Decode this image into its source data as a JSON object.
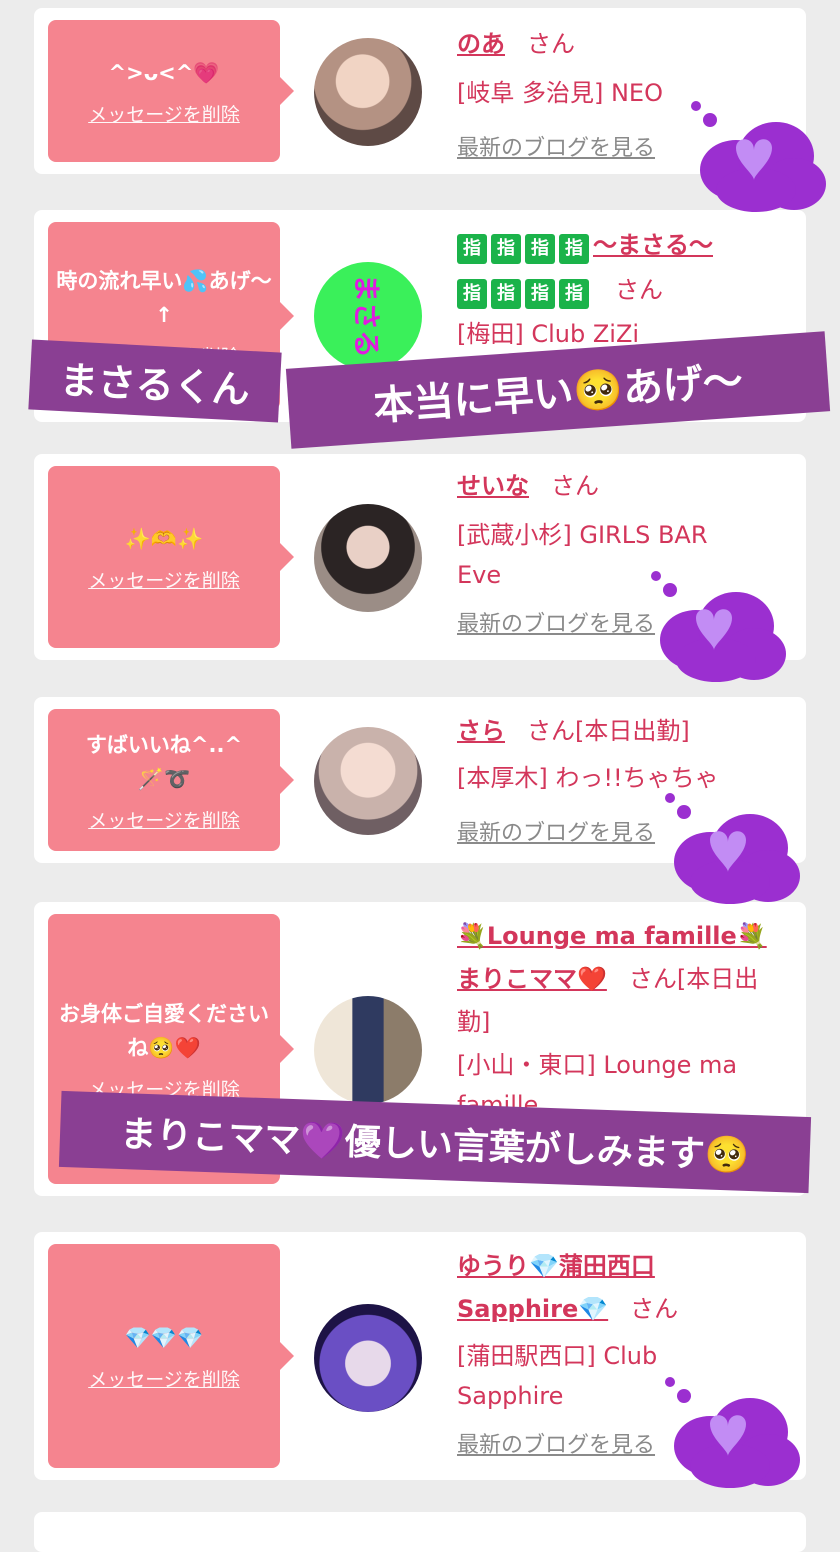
{
  "colors": {
    "bubble": "#f5848f",
    "accent": "#d3365b",
    "overlay": "#8a3f93",
    "cloud": "#9b2fd0"
  },
  "common": {
    "delete_label": "メッセージを削除",
    "blog_label": "最新のブログを見る",
    "san": "さん"
  },
  "cards": [
    {
      "message": "^>ᴗ<^💗",
      "name": "のあ",
      "shop": "[岐阜 多治見] NEO"
    },
    {
      "message": "時の流れ早い💦あげ〜↑",
      "name_fingers": [
        "指",
        "指",
        "指",
        "指"
      ],
      "name": "〜まさる〜",
      "name_fingers2": [
        "指",
        "指",
        "指",
        "指"
      ],
      "avatar_text": "まさる",
      "shop": "[梅田] Club ZiZi"
    },
    {
      "message": "✨🫶✨",
      "name": "せいな",
      "shop": "[武蔵小杉] GIRLS BAR Eve"
    },
    {
      "message": "すばいいね^..^🪄➰",
      "name": "さら",
      "status": "[本日出勤]",
      "shop": "[本厚木] わっ!!ちゃちゃ"
    },
    {
      "message": "お身体ご自愛くださいね🥺❤️",
      "name_line1": "💐Lounge ma famille💐",
      "name": "まりこママ❤️",
      "status": "[本日出勤]",
      "shop": "[小山・東口] Lounge ma famille"
    },
    {
      "message": "💎💎💎",
      "name": "ゆうり💎蒲田西口 Sapphire💎",
      "shop": "[蒲田駅西口] Club Sapphire"
    }
  ],
  "overlays": {
    "a": "まさるくん",
    "b": "本当に早い🥺あげ〜",
    "c": "まりこママ💜優しい言葉がしみます🥺"
  },
  "cloud_icon": "purple-heart"
}
